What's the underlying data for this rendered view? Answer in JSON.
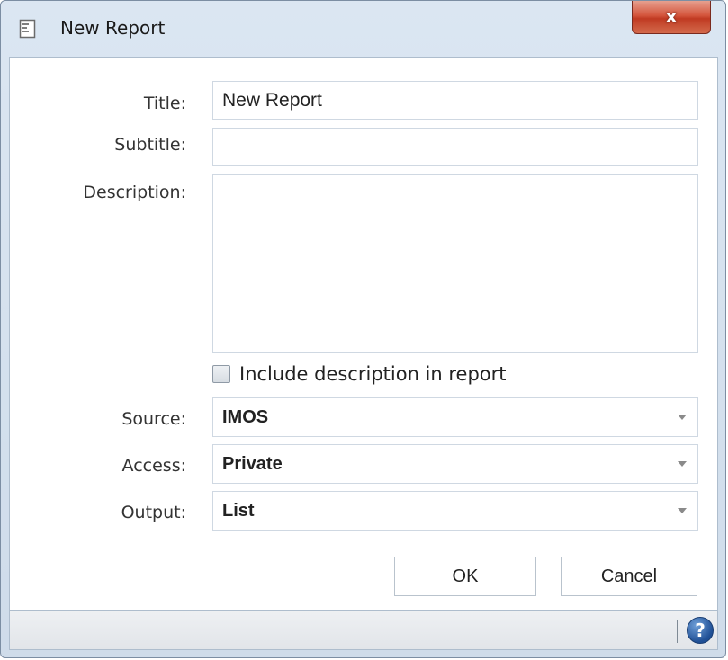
{
  "window": {
    "title": "New Report",
    "close_glyph": "x"
  },
  "form": {
    "title_label": "Title:",
    "title_value": "New Report",
    "subtitle_label": "Subtitle:",
    "subtitle_value": "",
    "description_label": "Description:",
    "description_value": "",
    "include_description_label": "Include description in report",
    "include_description_checked": false,
    "source_label": "Source:",
    "source_value": "IMOS",
    "access_label": "Access:",
    "access_value": "Private",
    "output_label": "Output:",
    "output_value": "List"
  },
  "buttons": {
    "ok_label": "OK",
    "cancel_label": "Cancel"
  },
  "statusbar": {
    "help_glyph": "?"
  },
  "icons": {
    "title": "report-icon",
    "close": "close-icon",
    "help": "help-icon",
    "dropdown": "chevron-down-icon"
  },
  "colors": {
    "close_button": "#c03a22",
    "help_icon": "#1f4f95",
    "window_frame": "#cfdcea"
  }
}
